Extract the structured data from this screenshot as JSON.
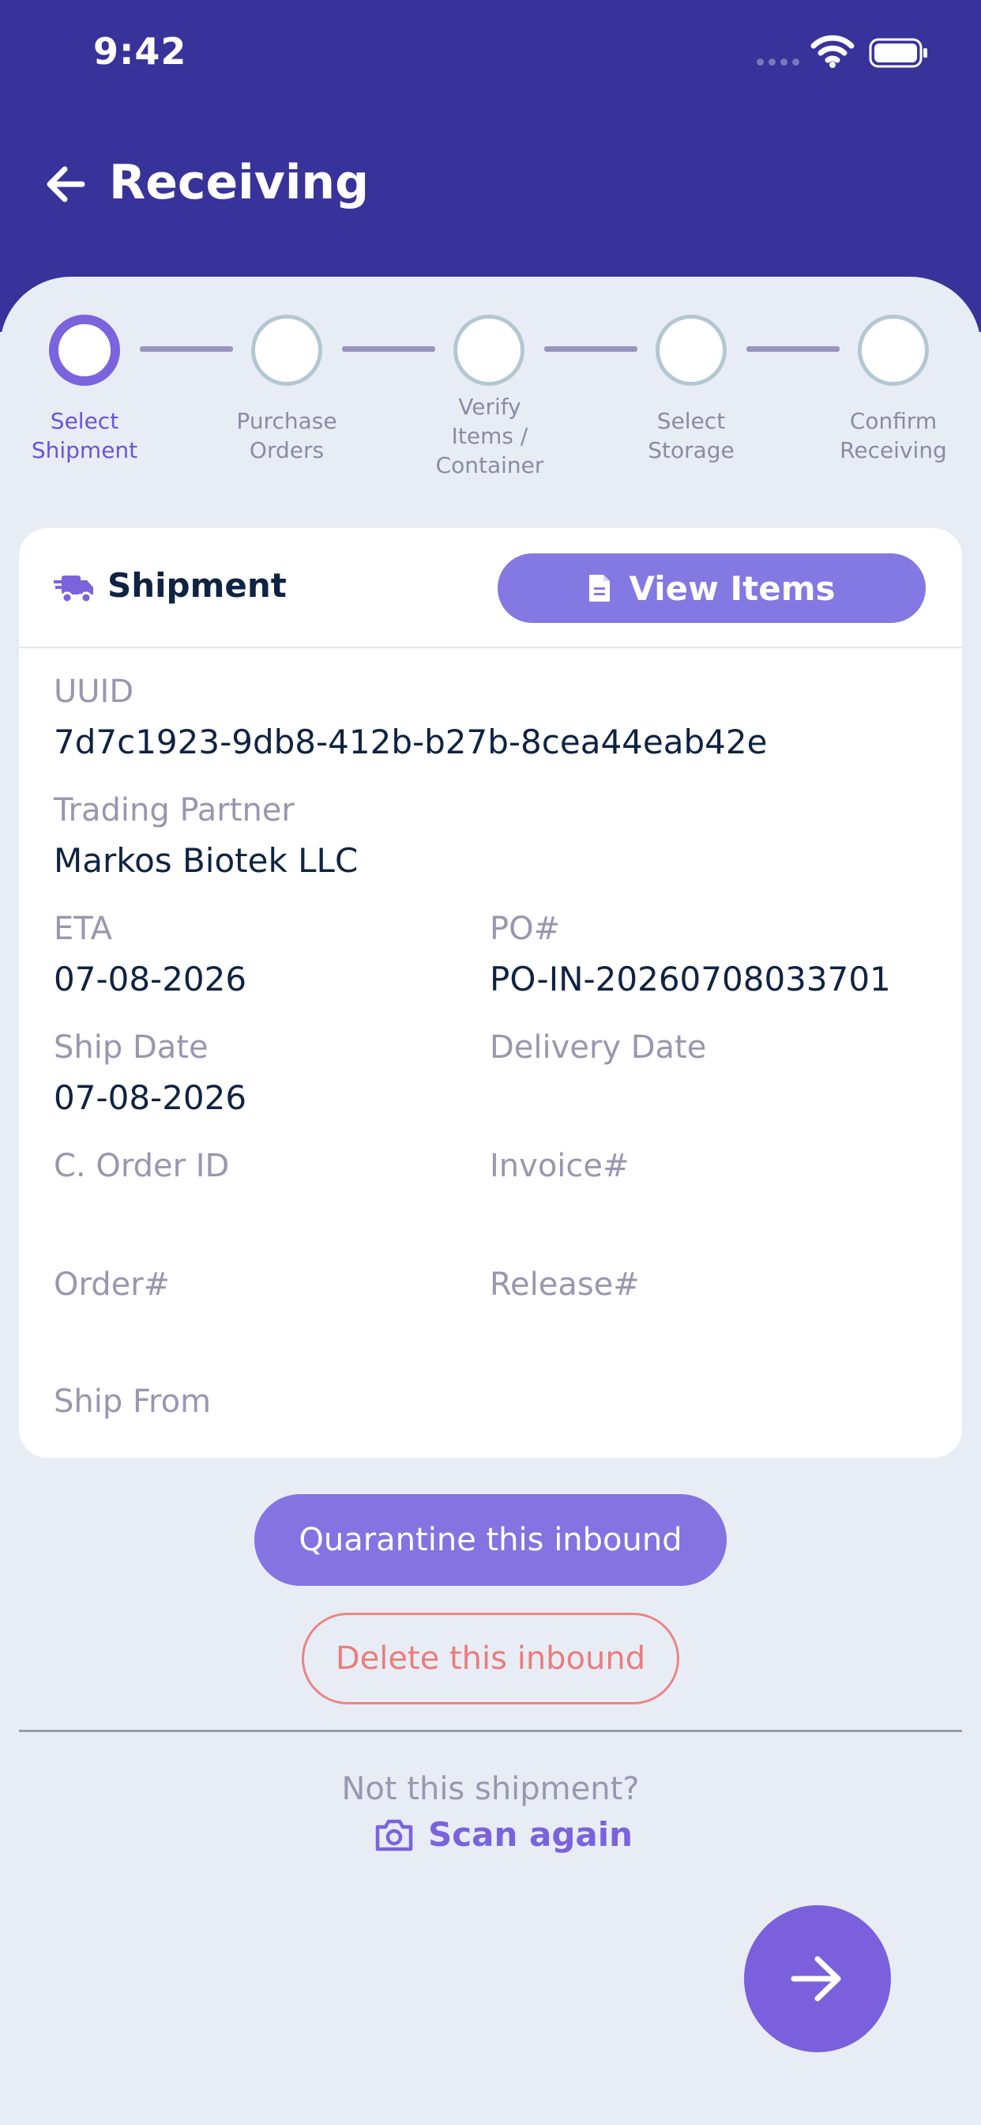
{
  "status_bar": {
    "time": "9:42"
  },
  "header": {
    "title": "Receiving"
  },
  "stepper": {
    "steps": [
      {
        "label": "Select Shipment",
        "active": true
      },
      {
        "label": "Purchase Orders",
        "active": false
      },
      {
        "label": "Verify Items / Container",
        "active": false
      },
      {
        "label": "Select Storage",
        "active": false
      },
      {
        "label": "Confirm Receiving",
        "active": false
      }
    ]
  },
  "card": {
    "title": "Shipment",
    "view_items_label": "View Items",
    "fields": {
      "uuid": {
        "label": "UUID",
        "value": "7d7c1923-9db8-412b-b27b-8cea44eab42e"
      },
      "trading_partner": {
        "label": "Trading Partner",
        "value": "Markos Biotek LLC"
      },
      "eta": {
        "label": "ETA",
        "value": "07-08-2026"
      },
      "po": {
        "label": "PO#",
        "value": "PO-IN-20260708033701"
      },
      "ship_date": {
        "label": "Ship Date",
        "value": "07-08-2026"
      },
      "delivery_date": {
        "label": "Delivery Date",
        "value": ""
      },
      "c_order_id": {
        "label": "C. Order ID",
        "value": ""
      },
      "invoice": {
        "label": "Invoice#",
        "value": ""
      },
      "order": {
        "label": "Order#",
        "value": ""
      },
      "release": {
        "label": "Release#",
        "value": ""
      },
      "ship_from": {
        "label": "Ship From",
        "value": ""
      }
    }
  },
  "actions": {
    "quarantine_label": "Quarantine this inbound",
    "delete_label": "Delete this inbound",
    "not_this_label": "Not this shipment?",
    "scan_again_label": "Scan again"
  },
  "colors": {
    "header_bg": "#37339a",
    "accent": "#7a63dc",
    "danger": "#ea7d7d",
    "background": "#e8edf5"
  },
  "icons": {
    "back": "arrow-left-icon",
    "truck": "truck-icon",
    "document": "document-icon",
    "camera": "camera-icon",
    "next": "arrow-right-icon"
  }
}
